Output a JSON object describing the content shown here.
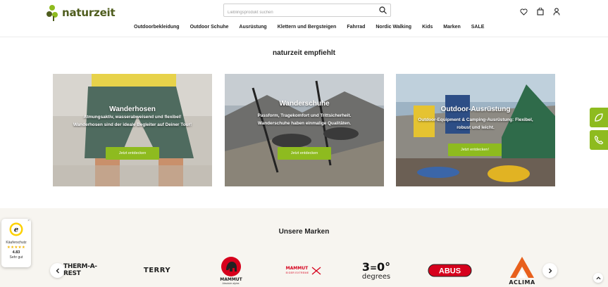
{
  "header": {
    "logo_text": "naturzeit",
    "search": {
      "placeholder": "Lieblingsprodukt suchen",
      "value": ""
    },
    "icons": [
      "heart-icon",
      "bag-icon",
      "user-icon"
    ]
  },
  "nav": {
    "items": [
      "Outdoorbekleidung",
      "Outdoor Schuhe",
      "Ausrüstung",
      "Klettern und Bergsteigen",
      "Fahrrad",
      "Nordic Walking",
      "Kids",
      "Marken",
      "SALE"
    ]
  },
  "recommend": {
    "title": "naturzeit empfiehlt",
    "cards": [
      {
        "title": "Wanderhosen",
        "description": "Atmungsaktiv, wasserabweisend und flexibel! Wanderhosen sind der ideale Begleiter auf Deiner Tour!",
        "button": "Jetzt entdecken"
      },
      {
        "title": "Wanderschuhe",
        "description": "Passform, Tragekomfort und Trittsicherheit. Wanderschuhe haben einmalige Qualitäten.",
        "button": "Jetzt entdecken"
      },
      {
        "title": "Outdoor-Ausrüstung",
        "description": "Outdoor-Equipment & Camping-Ausrüstung: Flexibel, robust und leicht.",
        "button": "Jetzt entdecken!"
      }
    ]
  },
  "side_tabs": [
    "leaf-icon",
    "phone-icon"
  ],
  "brands": {
    "title": "Unsere Marken",
    "items": [
      "THERM-A-REST",
      "TERRY",
      "MAMMUT",
      "MAMMUT EIGER EXTREME",
      "360° degrees",
      "ABUS",
      "ACLIMA"
    ],
    "mammut_tagline": "Absolute alpine.",
    "eiger_line1": "MAMMUT",
    "eiger_line2": "EIGER EXTREME"
  },
  "trusted_shops": {
    "logo_letter": "e",
    "label": "Käuferschutz",
    "stars": "★★★★★",
    "score": "4.83",
    "verdict": "Sehr gut",
    "close": "×"
  },
  "colors": {
    "accent": "#8ebb1f",
    "logo": "#4f5d1e",
    "abus_red": "#d6001c",
    "aclima_orange": "#e8601c"
  }
}
